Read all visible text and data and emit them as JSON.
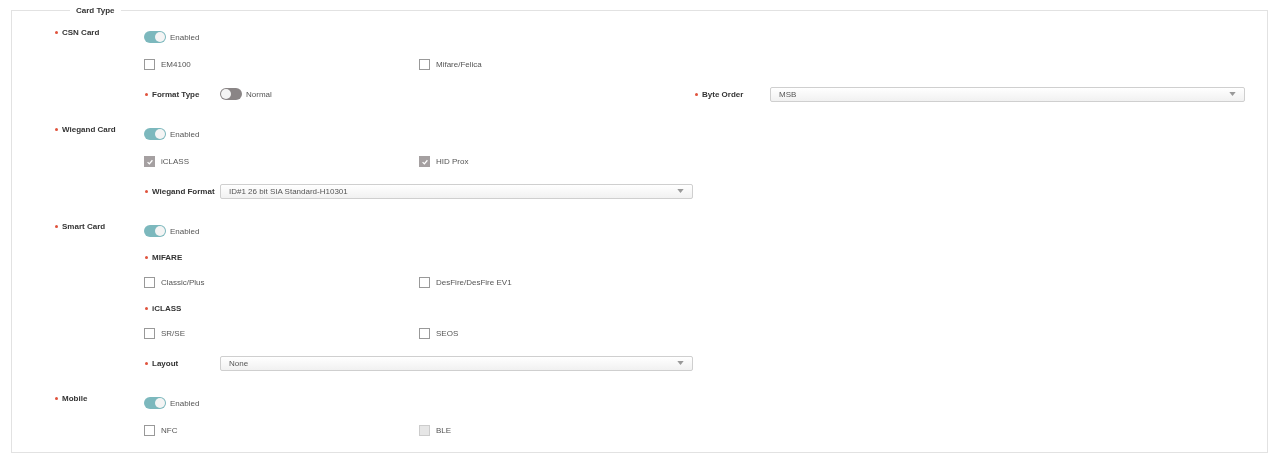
{
  "panel": {
    "title": "Card Type"
  },
  "sections": [
    {
      "label": "CSN Card",
      "required": true,
      "toggle": {
        "on": true,
        "text": "Enabled"
      },
      "items": [
        {
          "kind": "checkboxes",
          "options": [
            {
              "label": "EM4100",
              "checked": false,
              "disabled": false
            },
            {
              "label": "Mifare/Felica",
              "checked": false,
              "disabled": false
            }
          ]
        },
        {
          "kind": "fields",
          "fields": [
            {
              "kind": "switch",
              "label": "Format Type",
              "required": true,
              "on": false,
              "text": "Normal"
            },
            {
              "kind": "select",
              "label": "Byte Order",
              "required": true,
              "value": "MSB"
            }
          ]
        }
      ]
    },
    {
      "label": "Wiegand Card",
      "required": true,
      "toggle": {
        "on": true,
        "text": "Enabled"
      },
      "items": [
        {
          "kind": "checkboxes",
          "options": [
            {
              "label": "iCLASS",
              "checked": true,
              "disabled": true
            },
            {
              "label": "HID Prox",
              "checked": true,
              "disabled": true
            }
          ]
        },
        {
          "kind": "fields",
          "fields": [
            {
              "kind": "select",
              "label": "Wiegand Format",
              "required": true,
              "value": "ID#1 26 bit SIA Standard-H10301"
            }
          ]
        }
      ]
    },
    {
      "label": "Smart Card",
      "required": true,
      "toggle": {
        "on": true,
        "text": "Enabled"
      },
      "items": [
        {
          "kind": "heading",
          "label": "MIFARE",
          "required": true
        },
        {
          "kind": "checkboxes",
          "options": [
            {
              "label": "Classic/Plus",
              "checked": false,
              "disabled": false
            },
            {
              "label": "DesFire/DesFire EV1",
              "checked": false,
              "disabled": false
            }
          ]
        },
        {
          "kind": "heading",
          "label": "iCLASS",
          "required": true
        },
        {
          "kind": "checkboxes",
          "options": [
            {
              "label": "SR/SE",
              "checked": false,
              "disabled": false
            },
            {
              "label": "SEOS",
              "checked": false,
              "disabled": false
            }
          ]
        },
        {
          "kind": "fields",
          "fields": [
            {
              "kind": "select",
              "label": "Layout",
              "required": true,
              "value": "None"
            }
          ]
        }
      ]
    },
    {
      "label": "Mobile",
      "required": true,
      "toggle": {
        "on": true,
        "text": "Enabled"
      },
      "items": [
        {
          "kind": "checkboxes",
          "options": [
            {
              "label": "NFC",
              "checked": false,
              "disabled": false
            },
            {
              "label": "BLE",
              "checked": false,
              "disabled": true
            }
          ]
        }
      ]
    }
  ]
}
